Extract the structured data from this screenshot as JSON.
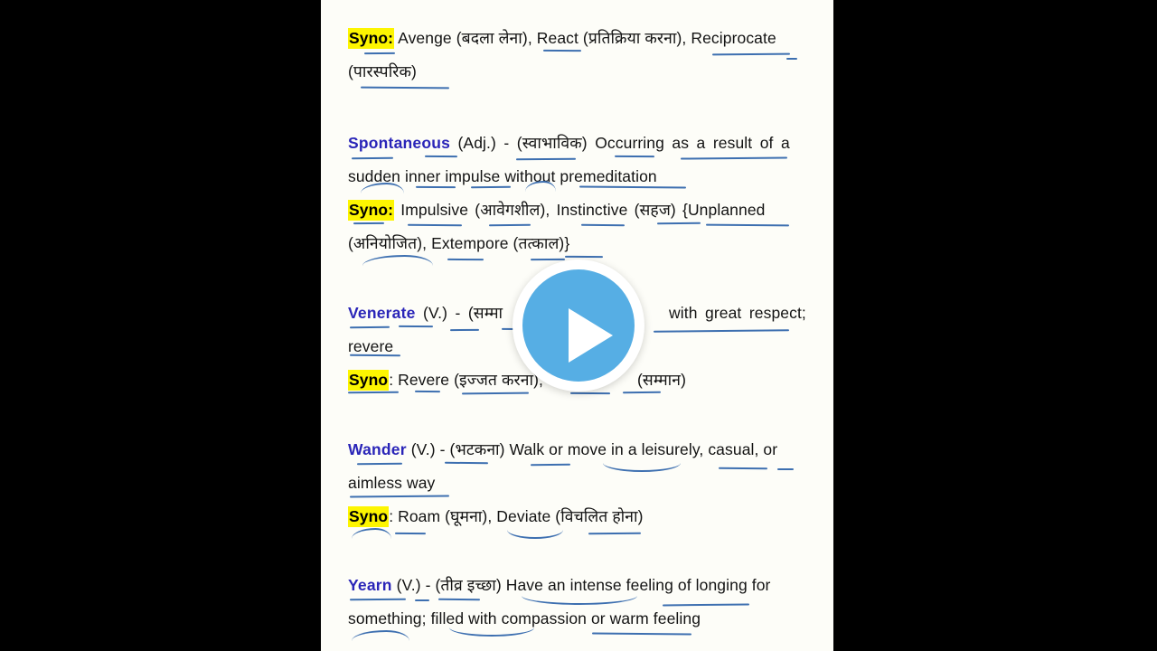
{
  "player": {
    "play_button_label": "Play",
    "accent_color": "#56aee4",
    "ring_color": "#ffffff",
    "letterbox_color": "#000000"
  },
  "page": {
    "background_color": "#fdfdf8",
    "headword_color": "#2a25b8",
    "highlight_color": "#fdf500",
    "underline_color": "#3d6fb0",
    "body_text_color": "#141414"
  },
  "entries": [
    {
      "id": "recompense-syno",
      "syno_label": "Syno:",
      "syno_body": " Avenge (बदला लेना), React (प्रतिक्रिया करना), Reciprocate",
      "syno_body_line2": "(पारस्परिक)"
    },
    {
      "id": "spontaneous",
      "headword": "Spontaneous",
      "meta": " (Adj.) - (स्वाभाविक) Occurring as a result of a",
      "definition_line2": "sudden inner impulse without premeditation",
      "syno_label": "Syno:",
      "syno_body": " Impulsive (आवेगशील), Instinctive (सहज) {Unplanned",
      "syno_body_line2": "(अनियोजित), Extempore (तत्काल)}"
    },
    {
      "id": "venerate",
      "headword": "Venerate",
      "meta": " (V.) - (सम्मा",
      "meta_tail": "with great respect;",
      "definition_line2": "revere",
      "syno_label": "Syno",
      "syno_body": ": Revere (इज्जत करना),",
      "syno_body_tail": "(सम्मान)"
    },
    {
      "id": "wander",
      "headword": "Wander",
      "meta": " (V.) - (भटकना) Walk or move in a leisurely, casual, or",
      "definition_line2": "aimless way",
      "syno_label": "Syno",
      "syno_body": ": Roam (घूमना), Deviate (विचलित होना)"
    },
    {
      "id": "yearn",
      "headword": "Yearn",
      "meta": " (V.) - (तीव्र इच्छा) Have an intense feeling of longing for",
      "definition_line2": "something; filled with compassion or warm feeling"
    }
  ]
}
